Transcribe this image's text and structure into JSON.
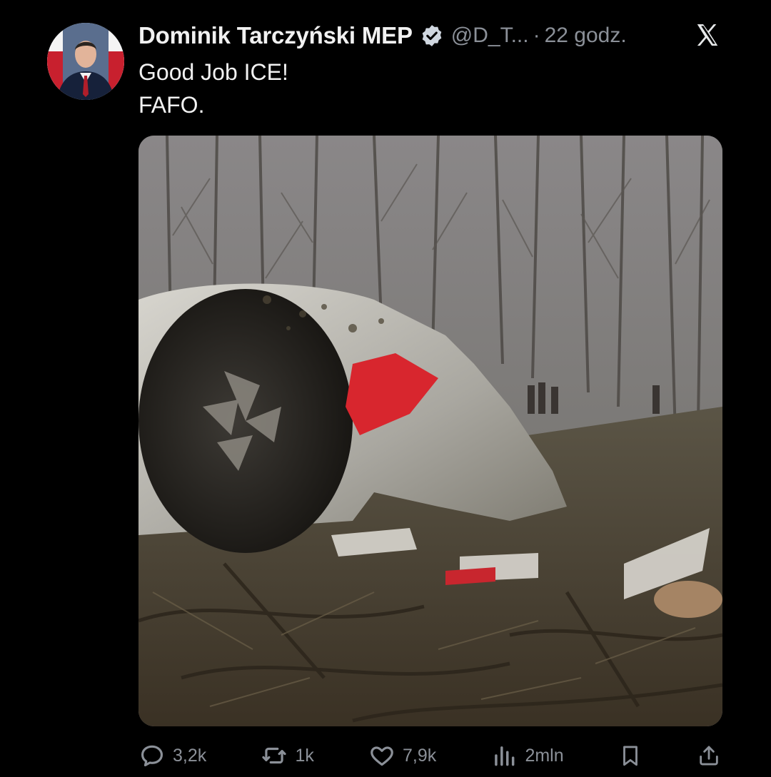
{
  "author": {
    "name": "Dominik Tarczyński MEP",
    "handle": "@D_T...",
    "separator": "·",
    "time": "22 godz."
  },
  "tweet": {
    "lines": [
      "Good Job ICE!",
      "FAFO."
    ]
  },
  "actions": {
    "replies": "3,2k",
    "reposts": "1k",
    "likes": "7,9k",
    "views": "2mln"
  },
  "colors": {
    "background": "#000000",
    "text": "#e7e9ea",
    "secondary": "#8b9098",
    "verified": "#d0d7e0"
  },
  "icons": {
    "verified": "verified-badge-icon",
    "brand": "x-logo-icon",
    "reply": "reply-icon",
    "repost": "repost-icon",
    "like": "heart-icon",
    "views": "views-bar-chart-icon",
    "bookmark": "bookmark-icon",
    "share": "share-icon"
  }
}
